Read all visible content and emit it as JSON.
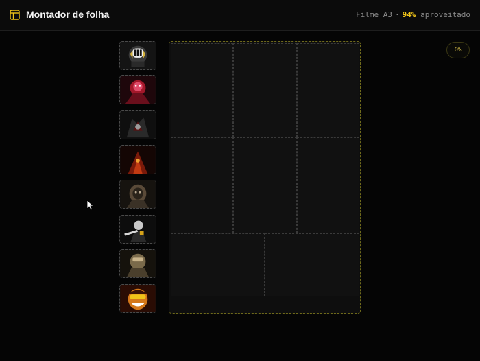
{
  "app": {
    "title": "Montador de folha",
    "icon": "layout-panel-icon"
  },
  "status": {
    "film": "Filme A3",
    "separator": "·",
    "usage_percent": "94%",
    "usage_label": "aproveitado"
  },
  "zoom_badge": "0%",
  "colors": {
    "accent": "#f0c419",
    "background": "#050505",
    "sheet_border": "#6f6a1a"
  },
  "thumbnails": [
    {
      "name": "thumb-1",
      "palette": [
        "#d6b33a",
        "#1a1a1a",
        "#f2f2f2"
      ]
    },
    {
      "name": "thumb-2",
      "palette": [
        "#a3182a",
        "#e04b6a",
        "#2a0c10"
      ]
    },
    {
      "name": "thumb-3",
      "palette": [
        "#4a0f0f",
        "#9b9b9b",
        "#1a1a1a"
      ]
    },
    {
      "name": "thumb-4",
      "palette": [
        "#7a1a0a",
        "#c23a12",
        "#1c0a06"
      ]
    },
    {
      "name": "thumb-5",
      "palette": [
        "#5a4a38",
        "#b8a890",
        "#1c1814"
      ]
    },
    {
      "name": "thumb-6",
      "palette": [
        "#c8c8c8",
        "#2a2a2a",
        "#d6a31a"
      ]
    },
    {
      "name": "thumb-7",
      "palette": [
        "#7a6a4a",
        "#c9b48a",
        "#1e1a12"
      ]
    },
    {
      "name": "thumb-8",
      "palette": [
        "#d4781a",
        "#f0c419",
        "#3a1206"
      ]
    }
  ],
  "sheet": {
    "slots": 8
  }
}
